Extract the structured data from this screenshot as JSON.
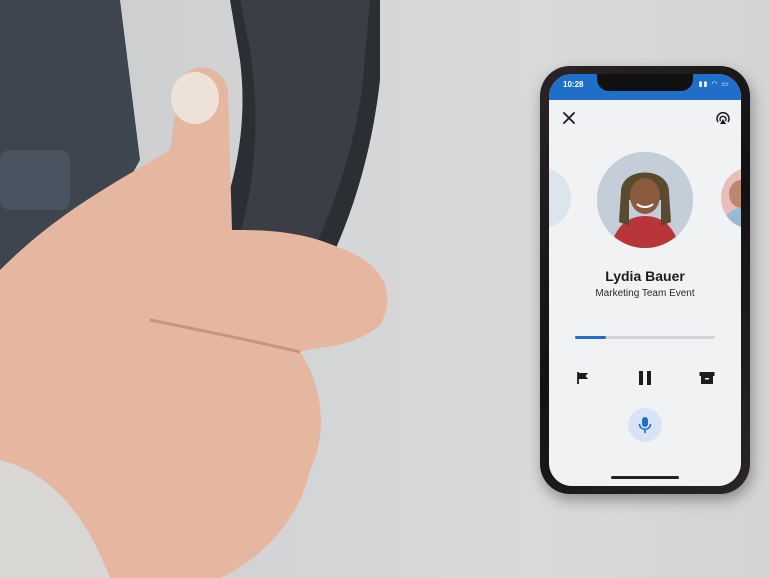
{
  "status_bar": {
    "time": "10:28",
    "icons": "▮▮ ◠ ▭"
  },
  "toolbar": {
    "close_icon": "close-icon",
    "cast_icon": "cast-icon"
  },
  "contact": {
    "name": "Lydia Bauer",
    "subtitle": "Marketing Team Event"
  },
  "playback": {
    "progress_fraction": 0.22
  },
  "controls": {
    "flag_icon": "flag-icon",
    "pause_icon": "pause-icon",
    "archive_icon": "archive-icon",
    "mic_icon": "microphone-icon"
  },
  "colors": {
    "accent": "#1f6fc8",
    "mic_bg": "#d8e4f3"
  }
}
